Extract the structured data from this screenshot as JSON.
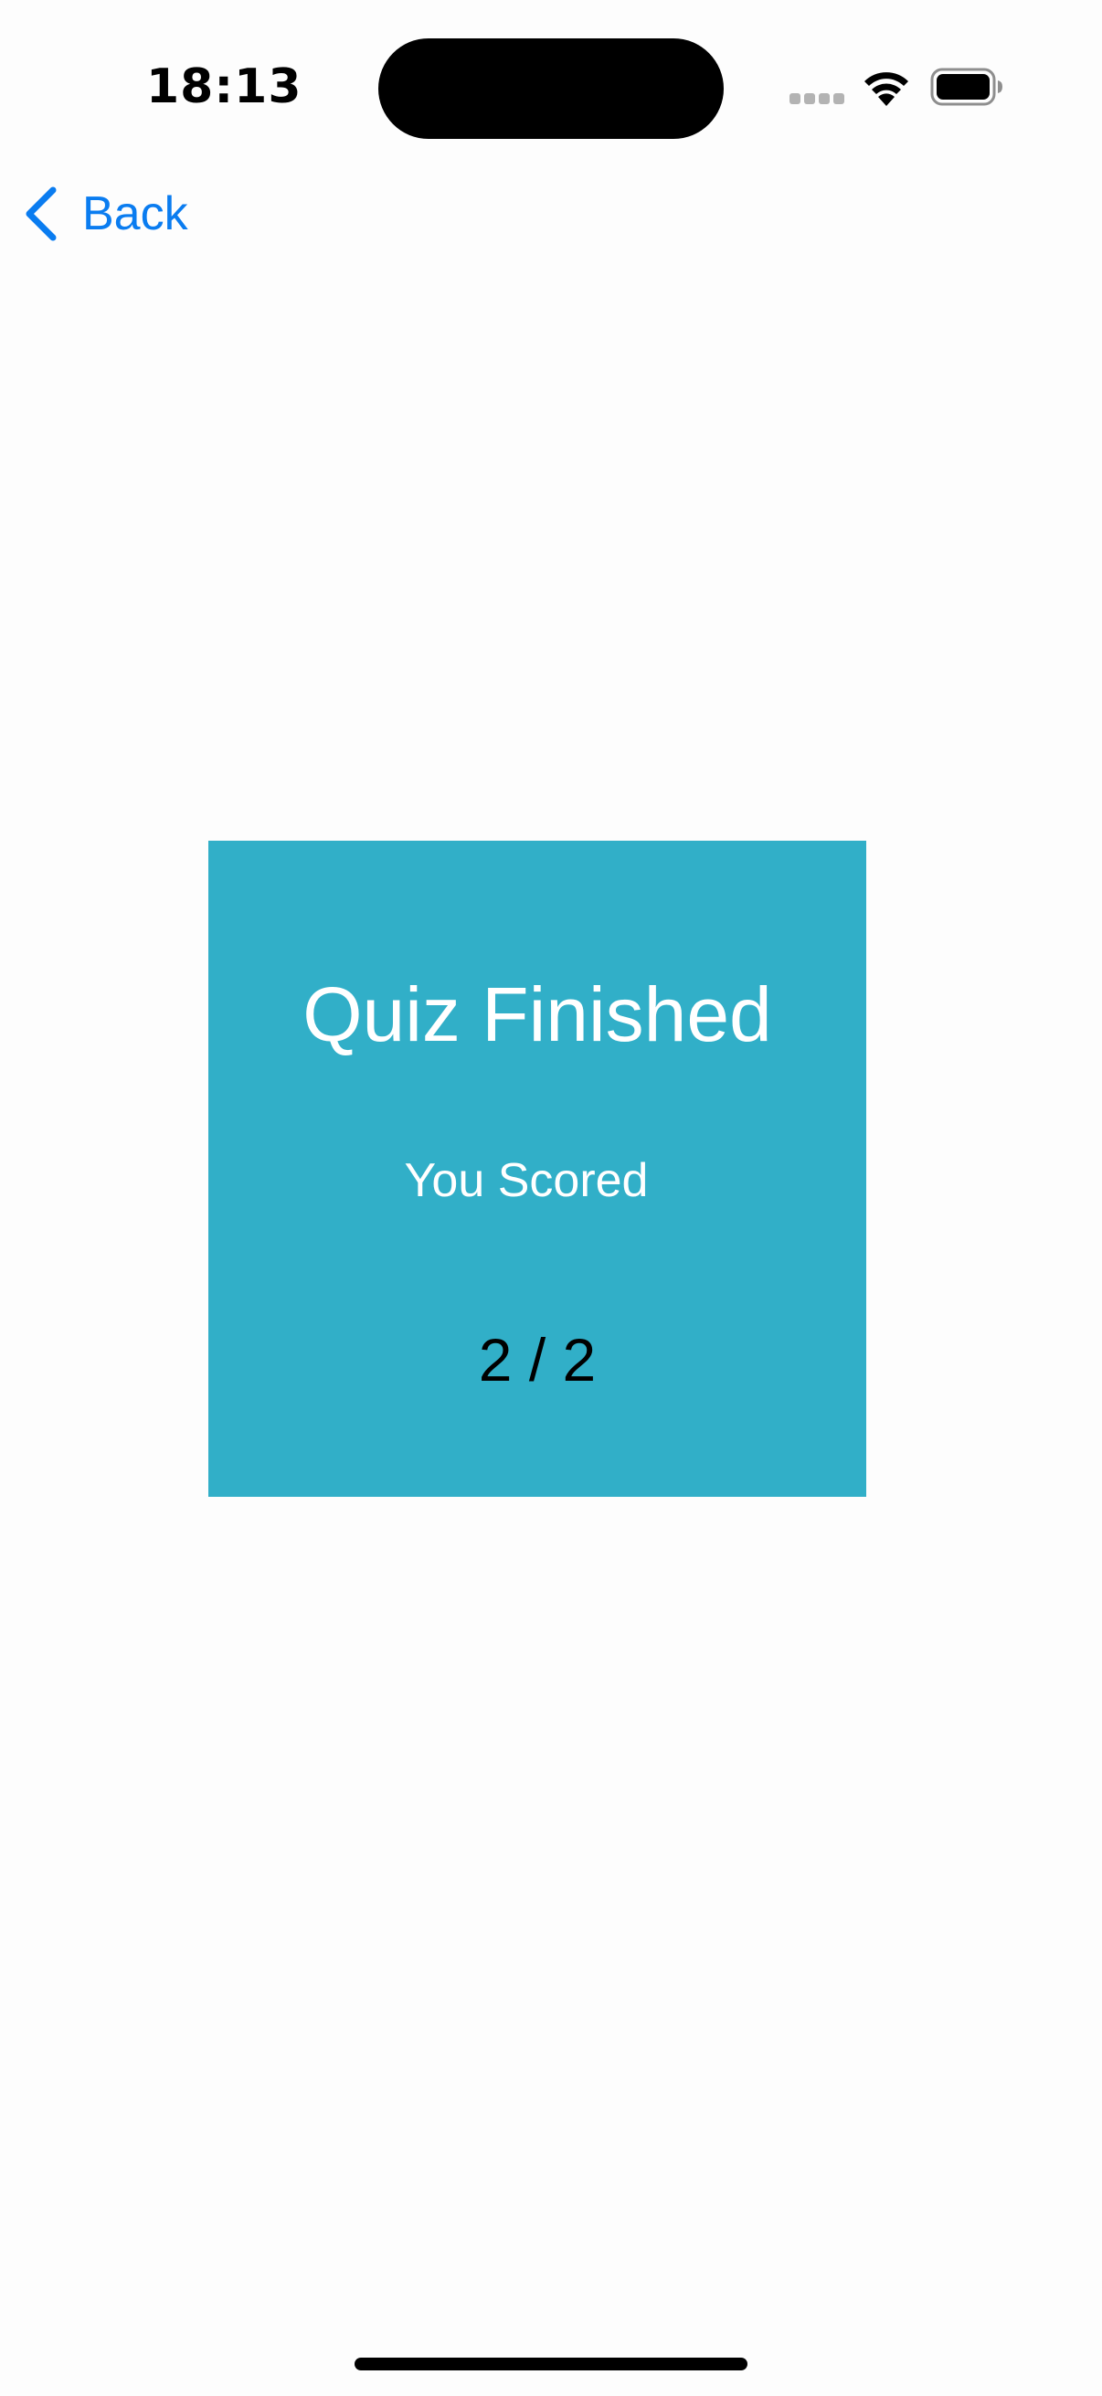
{
  "status_bar": {
    "time": "18:13",
    "icons": [
      "cell-signal-icon",
      "wifi-icon",
      "battery-icon"
    ]
  },
  "nav": {
    "back_label": "Back",
    "back_icon": "chevron-left-icon",
    "accent_color": "#0a7cf0"
  },
  "result": {
    "title": "Quiz Finished",
    "subtitle": "You Scored",
    "score": "2 / 2",
    "card_color": "#31afc8"
  }
}
